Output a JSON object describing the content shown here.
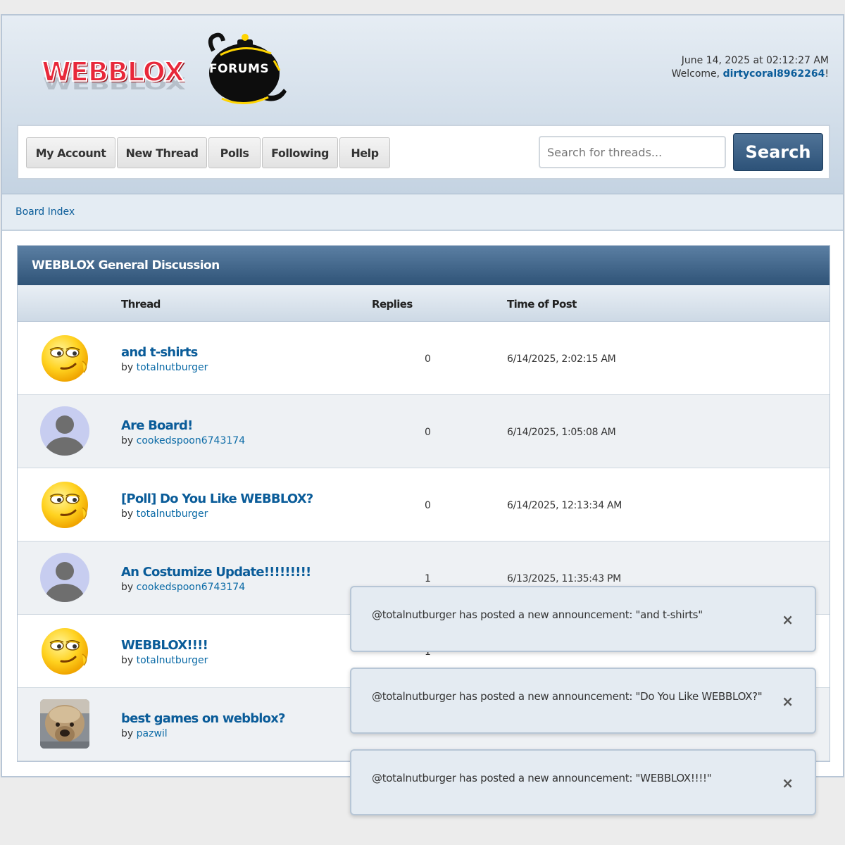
{
  "header": {
    "logo_text": "WEBBLOX",
    "forums_label": "FORUMS",
    "datetime": "June 14, 2025 at 02:12:27 AM",
    "welcome_prefix": "Welcome, ",
    "username": "dirtycoral8962264",
    "welcome_suffix": "!"
  },
  "nav": {
    "buttons": [
      "My Account",
      "New Thread",
      "Polls",
      "Following",
      "Help"
    ],
    "search_placeholder": "Search for threads...",
    "search_label": "Search"
  },
  "breadcrumb": "Board Index",
  "board": {
    "title": "WEBBLOX General Discussion",
    "columns": {
      "thread": "Thread",
      "replies": "Replies",
      "time": "Time of Post"
    },
    "by_prefix": "by ",
    "threads": [
      {
        "title": "and t-shirts",
        "author": "totalnutburger",
        "replies": "0",
        "time": "6/14/2025, 2:02:15 AM",
        "avatar": "smirk-emoji"
      },
      {
        "title": "Are Board!",
        "author": "cookedspoon6743174",
        "replies": "0",
        "time": "6/14/2025, 1:05:08 AM",
        "avatar": "default-user"
      },
      {
        "title": "[Poll] Do You Like WEBBLOX?",
        "author": "totalnutburger",
        "replies": "0",
        "time": "6/14/2025, 12:13:34 AM",
        "avatar": "smirk-emoji"
      },
      {
        "title": "An Costumize Update!!!!!!!!!",
        "author": "cookedspoon6743174",
        "replies": "1",
        "time": "6/13/2025, 11:35:43 PM",
        "avatar": "default-user"
      },
      {
        "title": "WEBBLOX!!!!",
        "author": "totalnutburger",
        "replies": "1",
        "time": "",
        "avatar": "smirk-emoji"
      },
      {
        "title": "best games on webblox?",
        "author": "pazwil",
        "replies": "",
        "time": "",
        "avatar": "dog-photo"
      }
    ]
  },
  "toasts": [
    {
      "text": "@totalnutburger has posted a new announcement: \"and t-shirts\"",
      "close": "×"
    },
    {
      "text": "@totalnutburger has posted a new announcement: \"Do You Like WEBBLOX?\"",
      "close": "×"
    },
    {
      "text": "@totalnutburger has posted a new announcement: \"WEBBLOX!!!!\"",
      "close": "×"
    }
  ]
}
